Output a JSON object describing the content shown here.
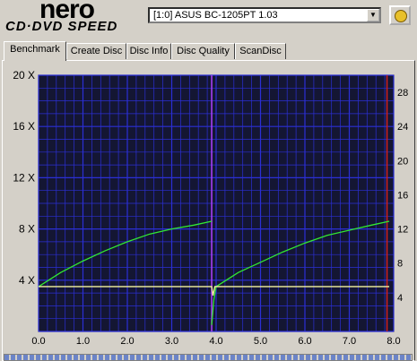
{
  "app": {
    "logo_top": "nero",
    "logo_bottom": "CD·DVD SPEED"
  },
  "drive": {
    "selected": "[1:0]   ASUS BC-1205PT 1.03"
  },
  "tabs": [
    {
      "label": "Benchmark",
      "active": true
    },
    {
      "label": "Create Disc",
      "active": false
    },
    {
      "label": "Disc Info",
      "active": false
    },
    {
      "label": "Disc Quality",
      "active": false
    },
    {
      "label": "ScanDisc",
      "active": false
    }
  ],
  "chart_data": {
    "type": "line",
    "y_left_ticks": [
      "20 X",
      "16 X",
      "12 X",
      "8 X",
      "4 X"
    ],
    "y_right_ticks": [
      "28",
      "24",
      "20",
      "16",
      "12",
      "8",
      "4"
    ],
    "x_ticks": [
      "0.0",
      "1.0",
      "2.0",
      "3.0",
      "4.0",
      "5.0",
      "6.0",
      "7.0",
      "8.0"
    ],
    "xlim": [
      0,
      8.0
    ],
    "ylim_left": [
      0,
      20
    ],
    "ylim_right": [
      0,
      30
    ],
    "grid": true,
    "series": [
      {
        "color": "#32e832",
        "x": [
          0,
          0.5,
          1,
          1.5,
          2,
          2.5,
          3,
          3.5,
          3.9
        ],
        "y": [
          3.5,
          4.6,
          5.5,
          6.3,
          7,
          7.6,
          8,
          8.3,
          8.6
        ]
      },
      {
        "color": "#32e832",
        "x": [
          3.9,
          3.95,
          4.0,
          4.5,
          5,
          5.5,
          6,
          6.5,
          7,
          7.5,
          7.9
        ],
        "y": [
          0.5,
          2.5,
          3.5,
          4.6,
          5.4,
          6.2,
          6.9,
          7.5,
          7.9,
          8.3,
          8.6
        ]
      },
      {
        "color": "#f4f4a0",
        "x": [
          0,
          3.9,
          3.93,
          3.97,
          4.0,
          7.9
        ],
        "y": [
          3.5,
          3.5,
          2.8,
          3.5,
          3.5,
          3.5
        ]
      }
    ],
    "markers": [
      {
        "x": 3.9,
        "color": "#b040ff"
      },
      {
        "x": 7.85,
        "color": "#d02020"
      }
    ]
  },
  "colors": {
    "plot_bg": "#141633",
    "grid": "#2b2fd6"
  }
}
